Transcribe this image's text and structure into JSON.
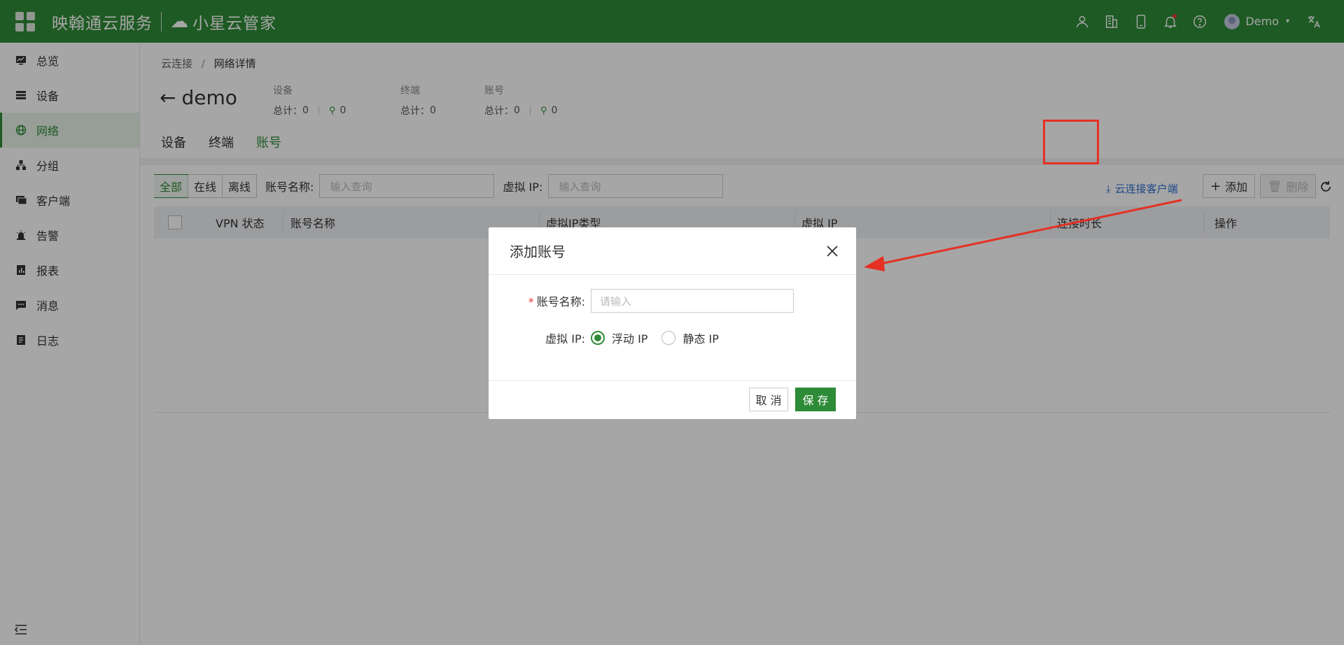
{
  "topbar": {
    "brand_name": "映翰通云服务",
    "product_name": "小星云管家",
    "username": "Demo",
    "icons": [
      "user-group-icon",
      "building-icon",
      "mobile-icon",
      "bell-icon",
      "help-icon",
      "translate-icon"
    ]
  },
  "sidebar": {
    "items": [
      {
        "label": "总览",
        "icon": "dashboard-icon"
      },
      {
        "label": "设备",
        "icon": "device-icon"
      },
      {
        "label": "网络",
        "icon": "globe-icon",
        "active": true
      },
      {
        "label": "分组",
        "icon": "group-icon"
      },
      {
        "label": "客户端",
        "icon": "client-icon"
      },
      {
        "label": "告警",
        "icon": "alarm-icon"
      },
      {
        "label": "报表",
        "icon": "report-icon"
      },
      {
        "label": "消息",
        "icon": "message-icon"
      },
      {
        "label": "日志",
        "icon": "log-icon"
      }
    ]
  },
  "breadcrumb": {
    "root": "云连接",
    "sep": "/",
    "current": "网络详情"
  },
  "page": {
    "title": "demo",
    "stats": [
      {
        "label": "设备",
        "total_label": "总计：",
        "total": "0",
        "connected": "0"
      },
      {
        "label": "终端",
        "total_label": "总计：",
        "total": "0"
      },
      {
        "label": "账号",
        "total_label": "总计：",
        "total": "0",
        "connected": "0"
      }
    ],
    "tabs": [
      "设备",
      "终端",
      "账号"
    ]
  },
  "toolbar": {
    "filters": [
      "全部",
      "在线",
      "离线"
    ],
    "name_label": "账号名称:",
    "name_placeholder": "输入查询",
    "ip_label": "虚拟 IP:",
    "ip_placeholder": "输入查询",
    "download_link": "云连接客户端",
    "add_label": "添加",
    "delete_label": "删除"
  },
  "table": {
    "columns": [
      "VPN 状态",
      "账号名称",
      "虚拟IP类型",
      "虚拟 IP",
      "连接时长",
      "操作"
    ]
  },
  "modal": {
    "title": "添加账号",
    "name_label": "账号名称:",
    "name_placeholder": "请输入",
    "ip_label": "虚拟 IP:",
    "ip_options": [
      "浮动 IP",
      "静态 IP"
    ],
    "ip_selected": "浮动 IP",
    "cancel_label": "取 消",
    "save_label": "保 存"
  },
  "annotation_color": "#e53023",
  "accent_color": "#2e8b37"
}
